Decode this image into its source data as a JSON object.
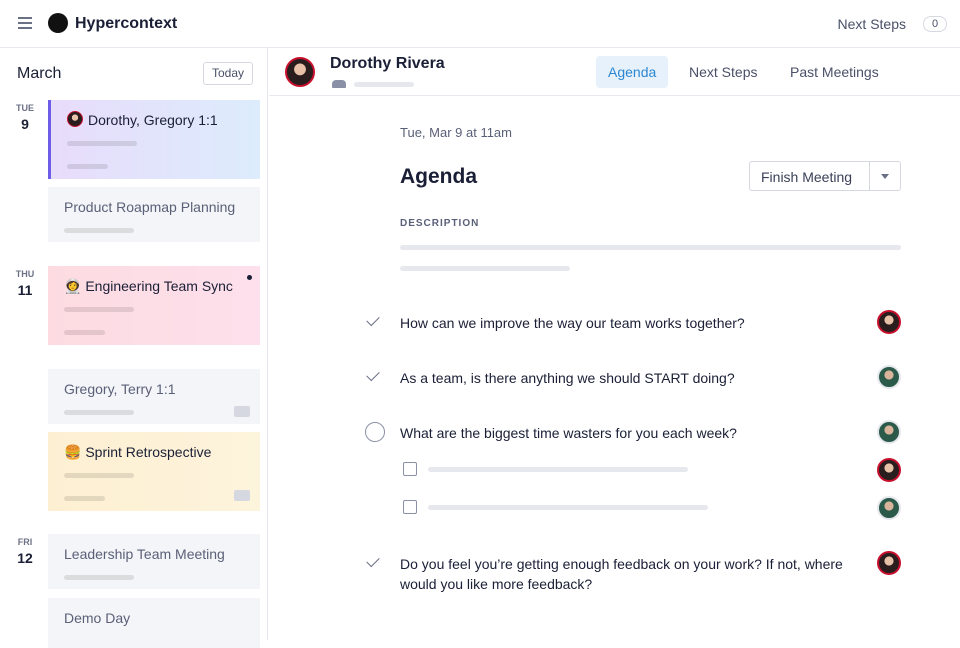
{
  "app": {
    "title": "Hypercontext",
    "next_steps_label": "Next Steps",
    "next_steps_count": "0"
  },
  "sidebar": {
    "month": "March",
    "today_label": "Today",
    "days": [
      {
        "dow": "TUE",
        "num": "9"
      },
      {
        "dow": "THU",
        "num": "11"
      },
      {
        "dow": "FRI",
        "num": "12"
      }
    ],
    "meetings": [
      "Dorothy, Gregory 1:1",
      "Product Roapmap Planning",
      "Engineering Team Sync",
      "Gregory, Terry 1:1",
      "Sprint Retrospective",
      "Leadership Team Meeting",
      "Demo Day"
    ],
    "emoji": {
      "eng": "👩‍🚀",
      "sprint": "🍔"
    }
  },
  "main": {
    "person": "Dorothy Rivera",
    "tabs": [
      "Agenda",
      "Next Steps",
      "Past Meetings"
    ],
    "date": "Tue, Mar 9 at 11am",
    "title": "Agenda",
    "finish_label": "Finish Meeting",
    "description_label": "DESCRIPTION",
    "items": [
      "How can we improve the way our team works together?",
      "As a team, is there anything we should START doing?",
      "What are the biggest time wasters for you each week?",
      "Do you feel you’re getting enough feedback on your work? If not, where would you like more feedback?"
    ]
  }
}
